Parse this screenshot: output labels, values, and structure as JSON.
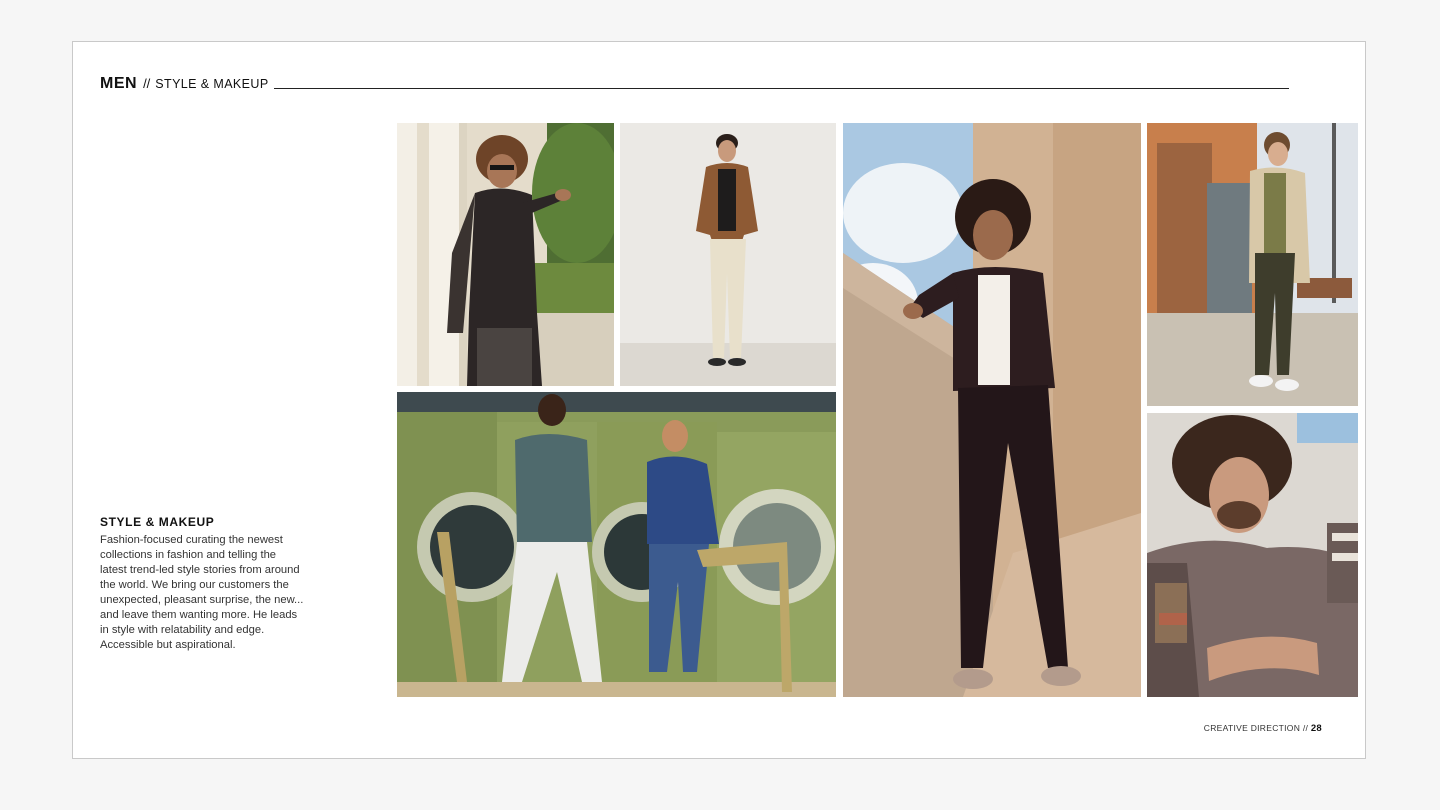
{
  "header": {
    "title": "MEN",
    "separator": "//",
    "subtitle": "STYLE & MAKEUP"
  },
  "intro": {
    "heading": "STYLE & MAKEUP",
    "body": "Fashion-focused curating the newest collections in fashion and telling the latest trend-led style stories from around the world. We bring our customers the unexpected, pleasant surprise, the new... and leave them wanting more. He leads in style with relatability and edge. Accessible but aspirational."
  },
  "photos": [
    {
      "name": "photo-curly-hair-sunglasses-man",
      "palette": [
        "#d8cdb5",
        "#2d2724",
        "#5e7f3a"
      ]
    },
    {
      "name": "photo-brown-jacket-man",
      "palette": [
        "#e8e6e2",
        "#8a5530",
        "#e7dfc9"
      ]
    },
    {
      "name": "photo-laundromat-two-men",
      "palette": [
        "#7c8d4f",
        "#2c3a66",
        "#e9e9e3"
      ]
    },
    {
      "name": "photo-man-against-concrete-wall",
      "palette": [
        "#c9a98b",
        "#2c1c1e",
        "#a9c6e0"
      ]
    },
    {
      "name": "photo-street-beige-coat-man",
      "palette": [
        "#c6b8a6",
        "#3e3d2c",
        "#d8cdb6"
      ]
    },
    {
      "name": "photo-wavy-hair-knit-sweater-man",
      "palette": [
        "#d9d5cf",
        "#6a5a55",
        "#3e2b22"
      ]
    }
  ],
  "footer": {
    "label": "CREATIVE DIRECTION",
    "separator": "//",
    "page_number": "28"
  }
}
